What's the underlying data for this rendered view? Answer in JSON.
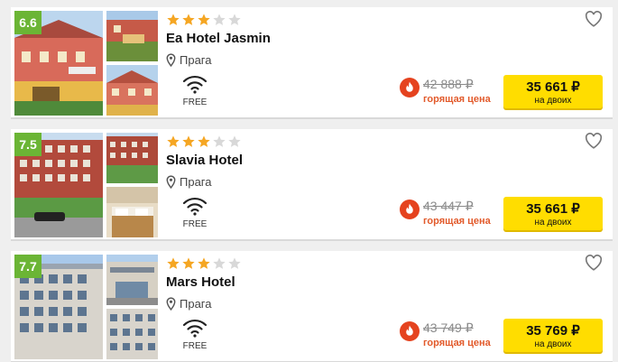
{
  "hotels": [
    {
      "rating": "6.6",
      "stars_filled": 3,
      "stars_total": 5,
      "name": "Ea Hotel Jasmin",
      "city": "Прага",
      "amenity_label": "FREE",
      "old_price": "42 888 ₽",
      "hot_label": "горящая цена",
      "price": "35 661 ₽",
      "price_note": "на двоих"
    },
    {
      "rating": "7.5",
      "stars_filled": 3,
      "stars_total": 5,
      "name": "Slavia Hotel",
      "city": "Прага",
      "amenity_label": "FREE",
      "old_price": "43 447 ₽",
      "hot_label": "горящая цена",
      "price": "35 661 ₽",
      "price_note": "на двоих"
    },
    {
      "rating": "7.7",
      "stars_filled": 3,
      "stars_total": 5,
      "name": "Mars Hotel",
      "city": "Прага",
      "amenity_label": "FREE",
      "old_price": "43 749 ₽",
      "hot_label": "горящая цена",
      "price": "35 769 ₽",
      "price_note": "на двоих"
    }
  ],
  "colors": {
    "rating_badge": "#6bb535",
    "star_filled": "#f5a623",
    "star_empty": "#d8d8d8",
    "price_button": "#ffdd00",
    "hot_label": "#e25a2b"
  },
  "icons": {
    "location": "map-pin-icon",
    "amenity": "wifi-icon",
    "favorite": "heart-icon",
    "hot_deal": "fire-icon",
    "star": "star-icon"
  }
}
